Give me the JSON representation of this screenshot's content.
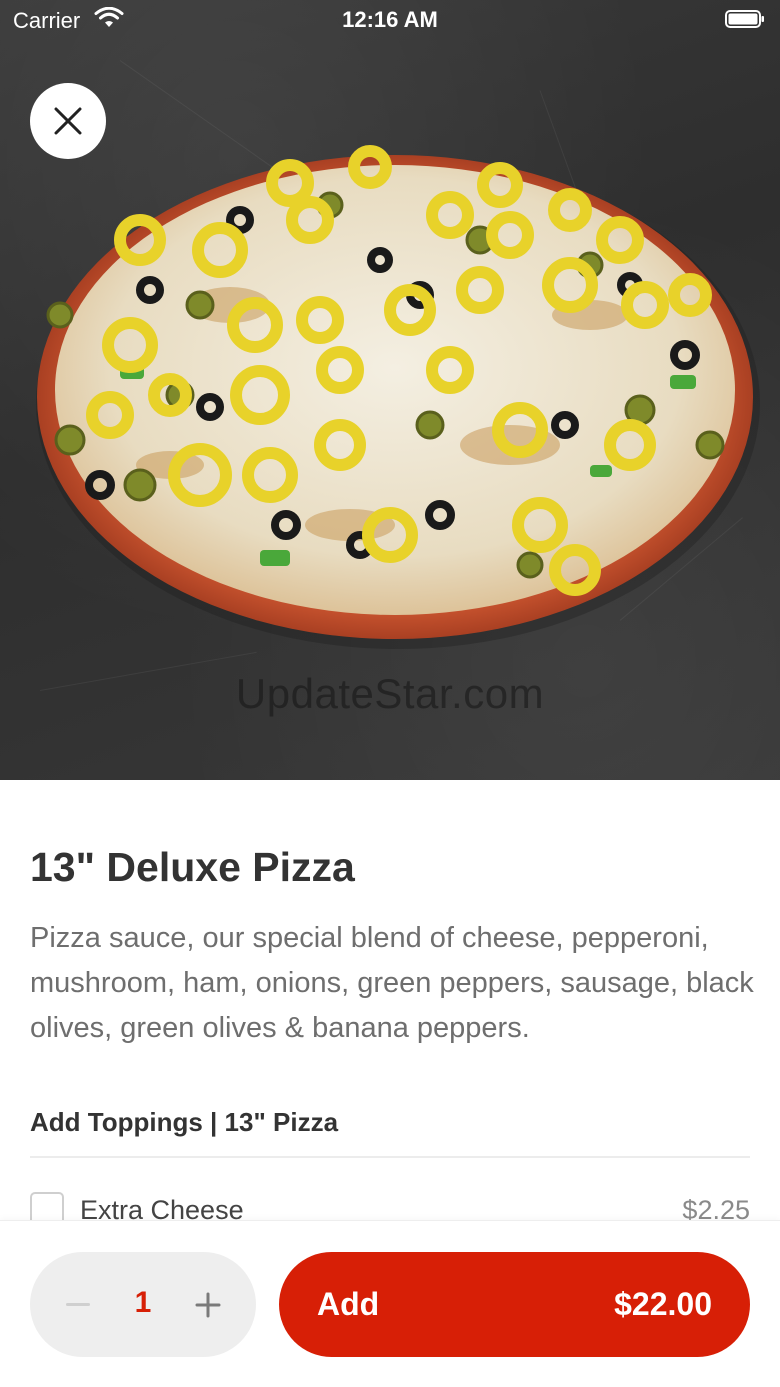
{
  "status_bar": {
    "carrier": "Carrier",
    "time": "12:16 AM",
    "wifi_icon": "wifi-icon",
    "battery_icon": "battery-icon"
  },
  "hero": {
    "image_subject": "pizza-image",
    "watermark": "UpdateStar.com",
    "close_icon": "close-icon"
  },
  "item": {
    "title": "13\" Deluxe Pizza",
    "description": "Pizza sauce, our special blend of cheese, pepperoni, mushroom, ham, onions, green peppers, sausage, black olives, green olives & banana peppers."
  },
  "toppings": {
    "section_title": "Add Toppings | 13\" Pizza",
    "options": [
      {
        "label": "Extra Cheese",
        "price": "$2.25",
        "checked": false
      }
    ]
  },
  "order": {
    "quantity": "1",
    "add_label": "Add",
    "total": "$22.00"
  },
  "colors": {
    "accent": "#d71f06",
    "stepper_bg": "#eeeeee",
    "text_primary": "#333333",
    "text_secondary": "#6e6e6e"
  }
}
